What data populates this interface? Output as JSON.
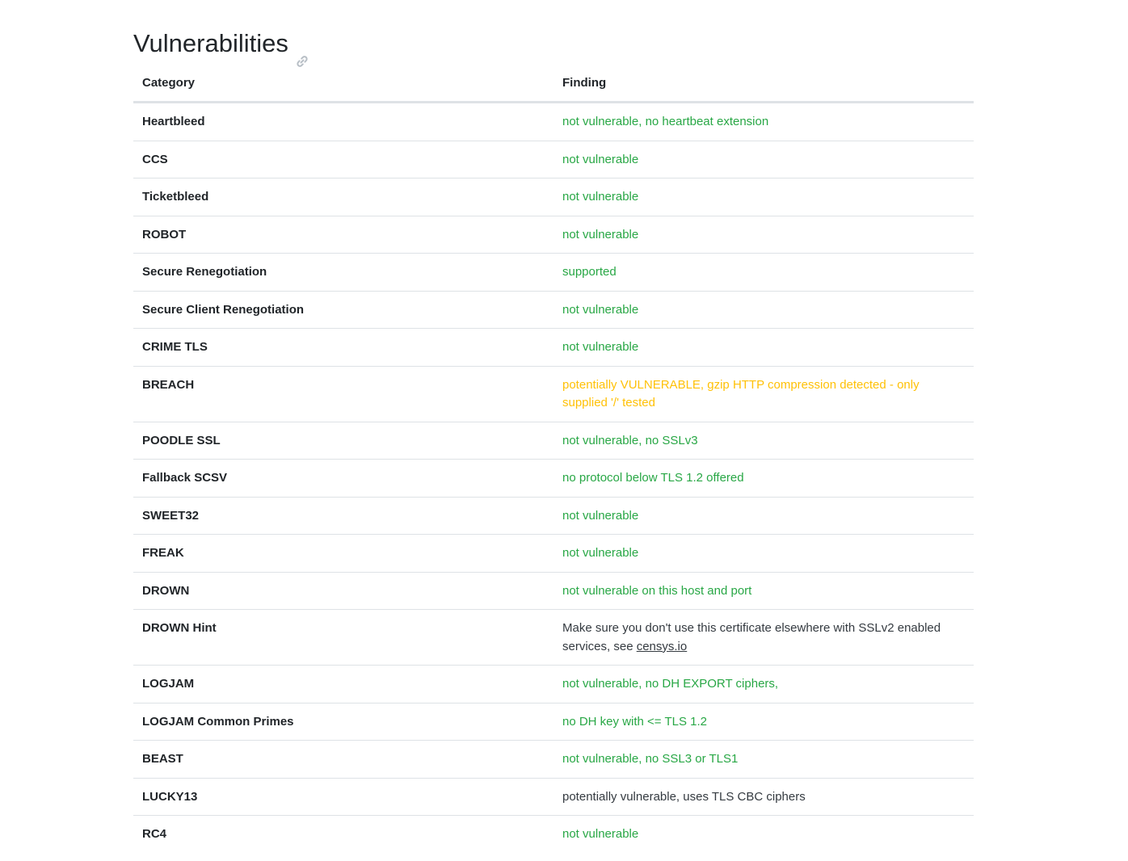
{
  "section": {
    "title": "Vulnerabilities",
    "anchor_icon": "link-icon"
  },
  "colors": {
    "ok": "#28a745",
    "warn": "#ffc107",
    "neutral": "#343a40"
  },
  "table": {
    "headers": {
      "category": "Category",
      "finding": "Finding"
    },
    "rows": [
      {
        "category": "Heartbleed",
        "finding": "not vulnerable, no heartbeat extension",
        "status": "ok"
      },
      {
        "category": "CCS",
        "finding": "not vulnerable",
        "status": "ok"
      },
      {
        "category": "Ticketbleed",
        "finding": "not vulnerable",
        "status": "ok"
      },
      {
        "category": "ROBOT",
        "finding": "not vulnerable",
        "status": "ok"
      },
      {
        "category": "Secure Renegotiation",
        "finding": "supported",
        "status": "ok"
      },
      {
        "category": "Secure Client Renegotiation",
        "finding": "not vulnerable",
        "status": "ok"
      },
      {
        "category": "CRIME TLS",
        "finding": "not vulnerable",
        "status": "ok"
      },
      {
        "category": "BREACH",
        "finding": "potentially VULNERABLE, gzip HTTP compression detected - only supplied '/' tested",
        "status": "warn"
      },
      {
        "category": "POODLE SSL",
        "finding": "not vulnerable, no SSLv3",
        "status": "ok"
      },
      {
        "category": "Fallback SCSV",
        "finding": "no protocol below TLS 1.2 offered",
        "status": "ok"
      },
      {
        "category": "SWEET32",
        "finding": "not vulnerable",
        "status": "ok"
      },
      {
        "category": "FREAK",
        "finding": "not vulnerable",
        "status": "ok"
      },
      {
        "category": "DROWN",
        "finding": "not vulnerable on this host and port",
        "status": "ok"
      },
      {
        "category": "DROWN Hint",
        "finding": "Make sure you don't use this certificate elsewhere with SSLv2 enabled services, see ",
        "link_text": "censys.io",
        "status": "neutral"
      },
      {
        "category": "LOGJAM",
        "finding": "not vulnerable, no DH EXPORT ciphers,",
        "status": "ok"
      },
      {
        "category": "LOGJAM Common Primes",
        "finding": "no DH key with <= TLS 1.2",
        "status": "ok"
      },
      {
        "category": "BEAST",
        "finding": "not vulnerable, no SSL3 or TLS1",
        "status": "ok"
      },
      {
        "category": "LUCKY13",
        "finding": "potentially vulnerable, uses TLS CBC ciphers",
        "status": "neutral"
      },
      {
        "category": "RC4",
        "finding": "not vulnerable",
        "status": "ok"
      }
    ]
  }
}
